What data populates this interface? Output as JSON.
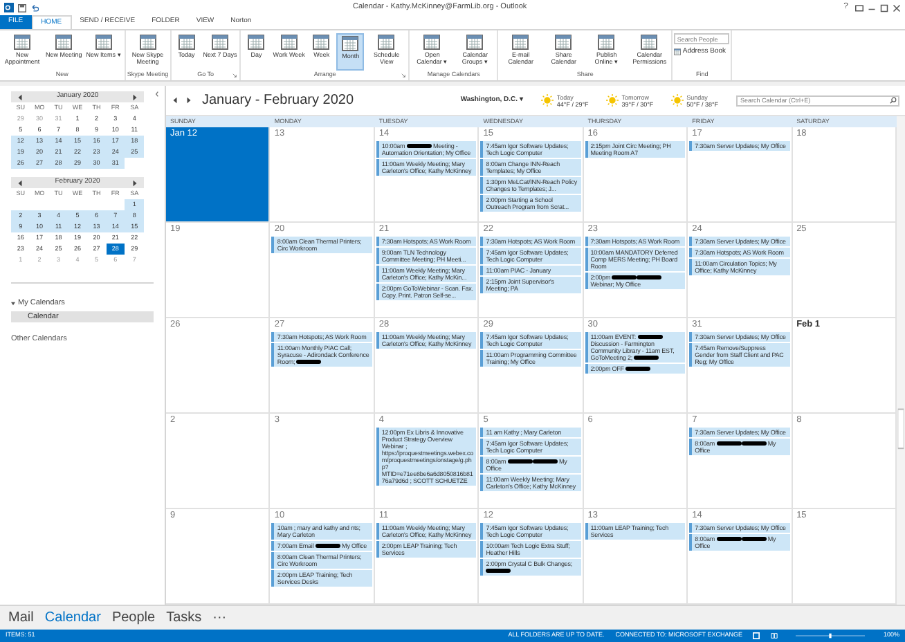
{
  "window": {
    "title": "Calendar - Kathy.McKinney@FarmLib.org - Outlook",
    "help": "?"
  },
  "ribbon": {
    "tabs": [
      {
        "label": "FILE",
        "kind": "file",
        "selected": false
      },
      {
        "label": "HOME",
        "kind": "tab",
        "selected": true
      },
      {
        "label": "SEND / RECEIVE",
        "kind": "tab",
        "selected": false
      },
      {
        "label": "FOLDER",
        "kind": "tab",
        "selected": false
      },
      {
        "label": "VIEW",
        "kind": "tab",
        "selected": false
      },
      {
        "label": "Norton",
        "kind": "tab",
        "selected": false
      }
    ],
    "groups": [
      {
        "label": "New",
        "kind": "buttons",
        "buttons": [
          {
            "label": "New Appointment",
            "selected": false
          },
          {
            "label": "New Meeting",
            "selected": false
          },
          {
            "label": "New Items ▾",
            "selected": false
          }
        ]
      },
      {
        "label": "Skype Meeting",
        "kind": "buttons",
        "buttons": [
          {
            "label": "New Skype Meeting",
            "selected": false
          }
        ]
      },
      {
        "label": "Go To",
        "kind": "buttons",
        "launcher": true,
        "buttons": [
          {
            "label": "Today",
            "selected": false
          },
          {
            "label": "Next 7 Days",
            "selected": false
          }
        ]
      },
      {
        "label": "Arrange",
        "kind": "buttons",
        "launcher": true,
        "buttons": [
          {
            "label": "Day",
            "selected": false
          },
          {
            "label": "Work Week",
            "selected": false
          },
          {
            "label": "Week",
            "selected": false
          },
          {
            "label": "Month",
            "selected": true
          },
          {
            "label": "Schedule View",
            "selected": false
          }
        ]
      },
      {
        "label": "Manage Calendars",
        "kind": "buttons",
        "buttons": [
          {
            "label": "Open Calendar ▾",
            "selected": false
          },
          {
            "label": "Calendar Groups ▾",
            "selected": false
          }
        ]
      },
      {
        "label": "Share",
        "kind": "buttons",
        "buttons": [
          {
            "label": "E-mail Calendar",
            "selected": false
          },
          {
            "label": "Share Calendar",
            "selected": false
          },
          {
            "label": "Publish Online ▾",
            "selected": false
          },
          {
            "label": "Calendar Permissions",
            "selected": false
          }
        ]
      },
      {
        "label": "Find",
        "kind": "find",
        "search": {
          "placeholder": "Search People"
        },
        "buttons": [
          {
            "label": "Address Book",
            "selected": false
          }
        ]
      }
    ]
  },
  "sidebar": {
    "mini_calendars": [
      {
        "title": "January 2020",
        "weekdays": [
          "SU",
          "MO",
          "TU",
          "WE",
          "TH",
          "FR",
          "SA"
        ],
        "weeks": [
          {
            "in_view": false,
            "days": [
              {
                "d": "29",
                "muted": true,
                "selected": false
              },
              {
                "d": "30",
                "muted": true,
                "selected": false
              },
              {
                "d": "31",
                "muted": true,
                "selected": false
              },
              {
                "d": "1",
                "muted": false,
                "selected": false
              },
              {
                "d": "2",
                "muted": false,
                "selected": false
              },
              {
                "d": "3",
                "muted": false,
                "selected": false
              },
              {
                "d": "4",
                "muted": false,
                "selected": false
              }
            ]
          },
          {
            "in_view": false,
            "days": [
              {
                "d": "5",
                "muted": false,
                "selected": false
              },
              {
                "d": "6",
                "muted": false,
                "selected": false
              },
              {
                "d": "7",
                "muted": false,
                "selected": false
              },
              {
                "d": "8",
                "muted": false,
                "selected": false
              },
              {
                "d": "9",
                "muted": false,
                "selected": false
              },
              {
                "d": "10",
                "muted": false,
                "selected": false
              },
              {
                "d": "11",
                "muted": false,
                "selected": false
              }
            ]
          },
          {
            "in_view": true,
            "days": [
              {
                "d": "12",
                "muted": false,
                "selected": false
              },
              {
                "d": "13",
                "muted": false,
                "selected": false
              },
              {
                "d": "14",
                "muted": false,
                "selected": false
              },
              {
                "d": "15",
                "muted": false,
                "selected": false
              },
              {
                "d": "16",
                "muted": false,
                "selected": false
              },
              {
                "d": "17",
                "muted": false,
                "selected": false
              },
              {
                "d": "18",
                "muted": false,
                "selected": false
              }
            ]
          },
          {
            "in_view": true,
            "days": [
              {
                "d": "19",
                "muted": false,
                "selected": false
              },
              {
                "d": "20",
                "muted": false,
                "selected": false
              },
              {
                "d": "21",
                "muted": false,
                "selected": false
              },
              {
                "d": "22",
                "muted": false,
                "selected": false
              },
              {
                "d": "23",
                "muted": false,
                "selected": false
              },
              {
                "d": "24",
                "muted": false,
                "selected": false
              },
              {
                "d": "25",
                "muted": false,
                "selected": false
              }
            ]
          },
          {
            "in_view": true,
            "days": [
              {
                "d": "26",
                "muted": false,
                "selected": false
              },
              {
                "d": "27",
                "muted": false,
                "selected": false
              },
              {
                "d": "28",
                "muted": false,
                "selected": false
              },
              {
                "d": "29",
                "muted": false,
                "selected": false
              },
              {
                "d": "30",
                "muted": false,
                "selected": false
              },
              {
                "d": "31",
                "muted": false,
                "selected": false
              }
            ]
          }
        ]
      },
      {
        "title": "February 2020",
        "weekdays": [
          "SU",
          "MO",
          "TU",
          "WE",
          "TH",
          "FR",
          "SA"
        ],
        "weeks": [
          {
            "in_view": true,
            "days": [
              {
                "d": "1",
                "muted": false,
                "selected": false
              }
            ]
          },
          {
            "in_view": true,
            "days": [
              {
                "d": "2",
                "muted": false,
                "selected": false
              },
              {
                "d": "3",
                "muted": false,
                "selected": false
              },
              {
                "d": "4",
                "muted": false,
                "selected": false
              },
              {
                "d": "5",
                "muted": false,
                "selected": false
              },
              {
                "d": "6",
                "muted": false,
                "selected": false
              },
              {
                "d": "7",
                "muted": false,
                "selected": false
              },
              {
                "d": "8",
                "muted": false,
                "selected": false
              }
            ]
          },
          {
            "in_view": true,
            "days": [
              {
                "d": "9",
                "muted": false,
                "selected": false
              },
              {
                "d": "10",
                "muted": false,
                "selected": false
              },
              {
                "d": "11",
                "muted": false,
                "selected": false
              },
              {
                "d": "12",
                "muted": false,
                "selected": false
              },
              {
                "d": "13",
                "muted": false,
                "selected": false
              },
              {
                "d": "14",
                "muted": false,
                "selected": false
              },
              {
                "d": "15",
                "muted": false,
                "selected": false
              }
            ]
          },
          {
            "in_view": false,
            "days": [
              {
                "d": "16",
                "muted": false,
                "selected": false
              },
              {
                "d": "17",
                "muted": false,
                "selected": false
              },
              {
                "d": "18",
                "muted": false,
                "selected": false
              },
              {
                "d": "19",
                "muted": false,
                "selected": false
              },
              {
                "d": "20",
                "muted": false,
                "selected": false
              },
              {
                "d": "21",
                "muted": false,
                "selected": false
              },
              {
                "d": "22",
                "muted": false,
                "selected": false
              }
            ]
          },
          {
            "in_view": false,
            "days": [
              {
                "d": "23",
                "muted": false,
                "selected": false
              },
              {
                "d": "24",
                "muted": false,
                "selected": false
              },
              {
                "d": "25",
                "muted": false,
                "selected": false
              },
              {
                "d": "26",
                "muted": false,
                "selected": false
              },
              {
                "d": "27",
                "muted": false,
                "selected": false
              },
              {
                "d": "28",
                "muted": false,
                "selected": true
              },
              {
                "d": "29",
                "muted": false,
                "selected": false
              }
            ]
          },
          {
            "in_view": false,
            "days": [
              {
                "d": "1",
                "muted": true,
                "selected": false
              },
              {
                "d": "2",
                "muted": true,
                "selected": false
              },
              {
                "d": "3",
                "muted": true,
                "selected": false
              },
              {
                "d": "4",
                "muted": true,
                "selected": false
              },
              {
                "d": "5",
                "muted": true,
                "selected": false
              },
              {
                "d": "6",
                "muted": true,
                "selected": false
              },
              {
                "d": "7",
                "muted": true,
                "selected": false
              }
            ]
          }
        ]
      }
    ],
    "my_calendars": {
      "label": "My Calendars",
      "expanded": true,
      "items": [
        {
          "label": "Calendar",
          "selected": true
        }
      ]
    },
    "other_calendars": {
      "label": "Other Calendars"
    }
  },
  "calendar": {
    "range": "January - February 2020",
    "location": "Washington, D.C.  ▾",
    "weather": [
      {
        "day": "Today",
        "temp": "44°F / 29°F"
      },
      {
        "day": "Tomorrow",
        "temp": "39°F / 30°F"
      },
      {
        "day": "Sunday",
        "temp": "50°F / 38°F"
      }
    ],
    "search": {
      "placeholder": "Search Calendar (Ctrl+E)"
    },
    "weekdays": [
      "SUNDAY",
      "MONDAY",
      "TUESDAY",
      "WEDNESDAY",
      "THURSDAY",
      "FRIDAY",
      "SATURDAY"
    ],
    "weeks": [
      {
        "days": [
          {
            "label": "Jan 12",
            "selected": true,
            "month_start": false
          },
          {
            "label": "13",
            "selected": false,
            "month_start": false
          },
          {
            "label": "14",
            "selected": false,
            "month_start": false,
            "events": [
              {
                "parts": [
                  "10:00am ",
                  {
                    "kind": "redacted"
                  },
                  " Meeting - Automation Orientation; My Office"
                ]
              },
              {
                "parts": [
                  "11:00am Weekly Meeting; Mary Carleton's Office; Kathy McKinney"
                ]
              }
            ]
          },
          {
            "label": "15",
            "selected": false,
            "month_start": false,
            "events": [
              {
                "parts": [
                  "7:45am Igor Software Updates; Tech Logic Computer"
                ]
              },
              {
                "parts": [
                  "8:00am Change INN-Reach Templates; My Office"
                ]
              },
              {
                "parts": [
                  "1:30pm MeLCat/INN-Reach Policy Changes to Templates; J..."
                ]
              },
              {
                "parts": [
                  "2:00pm Starting a School Outreach Program from Scrat..."
                ]
              }
            ]
          },
          {
            "label": "16",
            "selected": false,
            "month_start": false,
            "events": [
              {
                "parts": [
                  "2:15pm Joint Circ Meeting; PH Meeting Room A7"
                ]
              }
            ]
          },
          {
            "label": "17",
            "selected": false,
            "month_start": false,
            "events": [
              {
                "parts": [
                  "7:30am Server Updates; My Office"
                ]
              }
            ]
          },
          {
            "label": "18",
            "selected": false,
            "month_start": false
          }
        ]
      },
      {
        "days": [
          {
            "label": "19",
            "selected": false,
            "month_start": false
          },
          {
            "label": "20",
            "selected": false,
            "month_start": false,
            "events": [
              {
                "parts": [
                  "8:00am Clean Thermal Printers; Circ Workroom"
                ]
              }
            ]
          },
          {
            "label": "21",
            "selected": false,
            "month_start": false,
            "events": [
              {
                "parts": [
                  "7:30am Hotspots; AS Work Room"
                ]
              },
              {
                "parts": [
                  "9:00am TLN Technology Committee Meeting; PH Meeti..."
                ]
              },
              {
                "parts": [
                  "11:00am Weekly Meeting; Mary Carleton's Office; Kathy McKin..."
                ]
              },
              {
                "parts": [
                  "2:00pm GoToWebinar - Scan. Fax. Copy. Print. Patron Self-se..."
                ]
              }
            ]
          },
          {
            "label": "22",
            "selected": false,
            "month_start": false,
            "events": [
              {
                "parts": [
                  "7:30am Hotspots; AS Work Room"
                ]
              },
              {
                "parts": [
                  "7:45am Igor Software Updates; Tech Logic Computer"
                ]
              },
              {
                "parts": [
                  "11:00am PIAC - January"
                ]
              },
              {
                "parts": [
                  "2:15pm Joint Supervisor's Meeting; PA"
                ]
              }
            ]
          },
          {
            "label": "23",
            "selected": false,
            "month_start": false,
            "events": [
              {
                "parts": [
                  "7:30am Hotspots; AS Work Room"
                ]
              },
              {
                "parts": [
                  "10:00am MANDATORY Deferred Comp MERS Meeting; PH Board Room"
                ]
              },
              {
                "parts": [
                  "2:00pm ",
                  {
                    "kind": "redacted"
                  },
                  {
                    "kind": "redacted"
                  },
                  " Webinar; My Office"
                ]
              }
            ]
          },
          {
            "label": "24",
            "selected": false,
            "month_start": false,
            "events": [
              {
                "parts": [
                  "7:30am Server Updates; My Office"
                ]
              },
              {
                "parts": [
                  "7:30am Hotspots; AS Work Room"
                ]
              },
              {
                "parts": [
                  "11:00am Circulation Topics; My Office; Kathy McKinney"
                ]
              }
            ]
          },
          {
            "label": "25",
            "selected": false,
            "month_start": false
          }
        ]
      },
      {
        "days": [
          {
            "label": "26",
            "selected": false,
            "month_start": false
          },
          {
            "label": "27",
            "selected": false,
            "month_start": false,
            "events": [
              {
                "parts": [
                  "7:30am Hotspots; AS Work Room"
                ]
              },
              {
                "parts": [
                  "11:00am Monthly PIAC Call; Syracuse - Adirondack Conference Room; ",
                  {
                    "kind": "redacted"
                  }
                ]
              }
            ]
          },
          {
            "label": "28",
            "selected": false,
            "month_start": false,
            "events": [
              {
                "parts": [
                  "11:00am Weekly Meeting; Mary Carleton's Office; Kathy McKinney"
                ]
              }
            ]
          },
          {
            "label": "29",
            "selected": false,
            "month_start": false,
            "events": [
              {
                "parts": [
                  "7:45am Igor Software Updates; Tech Logic Computer"
                ]
              },
              {
                "parts": [
                  "11:00am Programming Committee Training; My Office"
                ]
              }
            ]
          },
          {
            "label": "30",
            "selected": false,
            "month_start": false,
            "events": [
              {
                "parts": [
                  "11:00am EVENT: ",
                  {
                    "kind": "redacted"
                  },
                  " Discussion - Farmington Community Library - 11am EST, GoToMeeting 2; ",
                  {
                    "kind": "redacted"
                  }
                ]
              },
              {
                "parts": [
                  "2:00pm OFF ",
                  {
                    "kind": "redacted"
                  }
                ]
              }
            ]
          },
          {
            "label": "31",
            "selected": false,
            "month_start": false,
            "events": [
              {
                "parts": [
                  "7:30am Server Updates; My Office"
                ]
              },
              {
                "parts": [
                  "7:45am Remove/Suppress Gender from Staff Client and PAC Reg; My Office"
                ]
              }
            ]
          },
          {
            "label": "Feb 1",
            "selected": false,
            "month_start": true
          }
        ]
      },
      {
        "days": [
          {
            "label": "2",
            "selected": false,
            "month_start": false
          },
          {
            "label": "3",
            "selected": false,
            "month_start": false
          },
          {
            "label": "4",
            "selected": false,
            "month_start": false,
            "events": [
              {
                "parts": [
                  "12:00pm Ex Libris & Innovative Product Strategy Overview Webinar ; https://proquestmeetings.webex.com/proquestmeetings/onstage/g.php?MTID=e71ee8be6a6d8050816b8176a79d6d ; SCOTT SCHUETZE"
                ]
              }
            ]
          },
          {
            "label": "5",
            "selected": false,
            "month_start": false,
            "events": [
              {
                "parts": [
                  "11 am Kathy ; Mary Carleton"
                ]
              },
              {
                "parts": [
                  "7:45am Igor Software Updates; Tech Logic Computer"
                ]
              },
              {
                "parts": [
                  "8:00am ",
                  {
                    "kind": "redacted"
                  },
                  {
                    "kind": "redacted"
                  },
                  " My Office"
                ]
              },
              {
                "parts": [
                  "11:00am Weekly Meeting; Mary Carleton's Office; Kathy McKinney"
                ]
              }
            ]
          },
          {
            "label": "6",
            "selected": false,
            "month_start": false
          },
          {
            "label": "7",
            "selected": false,
            "month_start": false,
            "events": [
              {
                "parts": [
                  "7:30am Server Updates; My Office"
                ]
              },
              {
                "parts": [
                  "8:00am ",
                  {
                    "kind": "redacted"
                  },
                  {
                    "kind": "redacted"
                  },
                  " My Office"
                ]
              }
            ]
          },
          {
            "label": "8",
            "selected": false,
            "month_start": false
          }
        ]
      },
      {
        "days": [
          {
            "label": "9",
            "selected": false,
            "month_start": false
          },
          {
            "label": "10",
            "selected": false,
            "month_start": false,
            "events": [
              {
                "parts": [
                  "10am ; mary and kathy and nts; Mary Carleton"
                ]
              },
              {
                "parts": [
                  "7:00am Email ",
                  {
                    "kind": "redacted"
                  },
                  " My Office"
                ]
              },
              {
                "parts": [
                  "8:00am Clean Thermal Printers; Circ Workroom"
                ]
              },
              {
                "parts": [
                  "2:00pm LEAP Training; Tech Services Desks"
                ]
              }
            ]
          },
          {
            "label": "11",
            "selected": false,
            "month_start": false,
            "events": [
              {
                "parts": [
                  "11:00am Weekly Meeting; Mary Carleton's Office; Kathy McKinney"
                ]
              },
              {
                "parts": [
                  "2:00pm LEAP Training; Tech Services"
                ]
              }
            ]
          },
          {
            "label": "12",
            "selected": false,
            "month_start": false,
            "events": [
              {
                "parts": [
                  "7:45am Igor Software Updates; Tech Logic Computer"
                ]
              },
              {
                "parts": [
                  "10:00am Tech Logic Extra Stuff; Heather Hills"
                ]
              },
              {
                "parts": [
                  "2:00pm Crystal C Bulk Changes; ",
                  {
                    "kind": "redacted"
                  }
                ]
              }
            ]
          },
          {
            "label": "13",
            "selected": false,
            "month_start": false,
            "events": [
              {
                "parts": [
                  "11:00am LEAP Training; Tech Services"
                ]
              }
            ]
          },
          {
            "label": "14",
            "selected": false,
            "month_start": false,
            "events": [
              {
                "parts": [
                  "7:30am Server Updates; My Office"
                ]
              },
              {
                "parts": [
                  "8:00am ",
                  {
                    "kind": "redacted"
                  },
                  {
                    "kind": "redacted"
                  },
                  " My Office"
                ]
              }
            ]
          },
          {
            "label": "15",
            "selected": false,
            "month_start": false
          }
        ]
      }
    ]
  },
  "nav": [
    {
      "label": "Mail",
      "selected": false
    },
    {
      "label": "Calendar",
      "selected": true
    },
    {
      "label": "People",
      "selected": false
    },
    {
      "label": "Tasks",
      "selected": false
    },
    {
      "label": "···",
      "selected": false
    }
  ],
  "status_bar": {
    "items": "ITEMS: 51",
    "sync": "ALL FOLDERS ARE UP TO DATE.",
    "connection": "CONNECTED TO: MICROSOFT EXCHANGE",
    "zoom": "100%",
    "zoom_slider": {
      "level": 0.5
    }
  }
}
